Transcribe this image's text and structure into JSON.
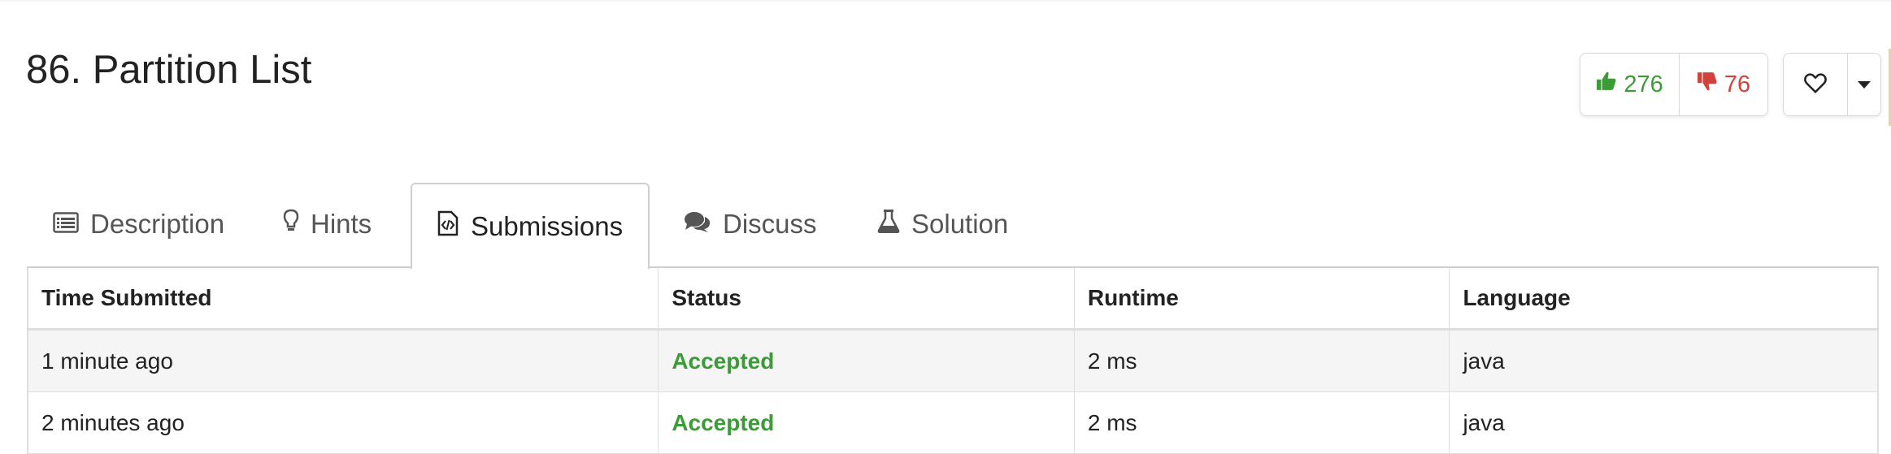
{
  "problem": {
    "title": "86. Partition List"
  },
  "votes": {
    "likes": "276",
    "dislikes": "76",
    "like_color": "#3a9c35",
    "dislike_color": "#d0423b",
    "like_icon": "thumbs-up-icon",
    "dislike_icon": "thumbs-down-icon",
    "favorite_icon": "heart-icon",
    "more_icon": "caret-down-icon"
  },
  "tabs": [
    {
      "label": "Description",
      "icon": "list-alt-icon",
      "active": false
    },
    {
      "label": "Hints",
      "icon": "lightbulb-icon",
      "active": false
    },
    {
      "label": "Submissions",
      "icon": "code-file-icon",
      "active": true
    },
    {
      "label": "Discuss",
      "icon": "comments-icon",
      "active": false
    },
    {
      "label": "Solution",
      "icon": "flask-icon",
      "active": false
    }
  ],
  "submissions": {
    "columns": [
      "Time Submitted",
      "Status",
      "Runtime",
      "Language"
    ],
    "rows": [
      {
        "time": "1 minute ago",
        "status": "Accepted",
        "runtime": "2 ms",
        "language": "java"
      },
      {
        "time": "2 minutes ago",
        "status": "Accepted",
        "runtime": "2 ms",
        "language": "java"
      }
    ],
    "accepted_color": "#3a9c35"
  }
}
